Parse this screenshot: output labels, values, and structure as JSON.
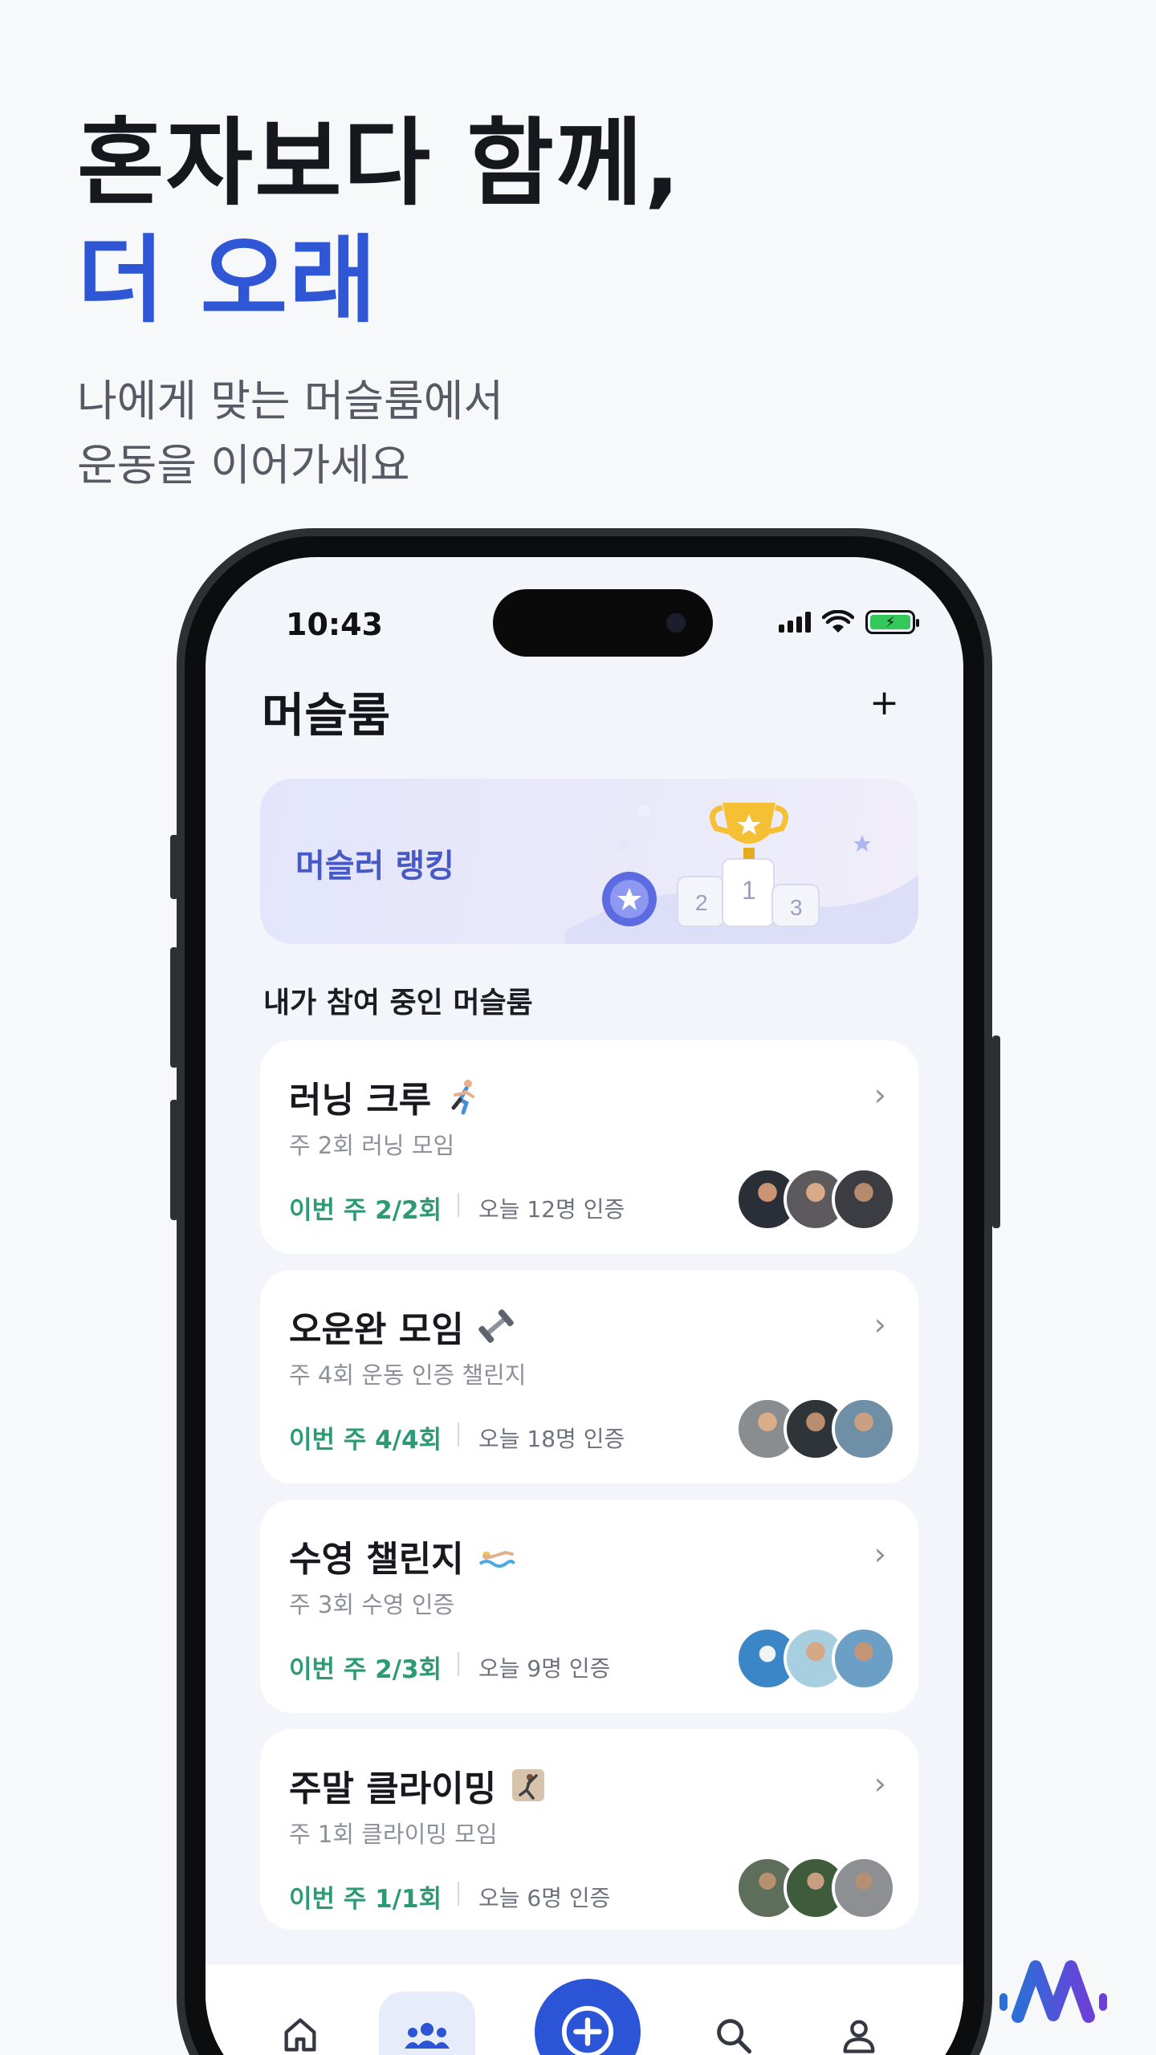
{
  "hero": {
    "line1": "혼자보다 함께,",
    "line2": "더 오래",
    "sub1": "나에게 맞는 머슬룸에서",
    "sub2": "운동을 이어가세요"
  },
  "status": {
    "time": "10:43"
  },
  "header": {
    "title": "머슬룸",
    "add_label": "+"
  },
  "banner": {
    "label": "머슬러 랭킹"
  },
  "section": {
    "title": "내가 참여 중인 머슬룸"
  },
  "rooms": [
    {
      "title": "러닝 크루",
      "emoji": "running-icon",
      "desc": "주 2회 러닝 모임",
      "week": "이번 주 2/2회",
      "today": "오늘 12명 인증"
    },
    {
      "title": "오운완 모임",
      "emoji": "dumbbell-icon",
      "desc": "주 4회 운동 인증 챌린지",
      "week": "이번 주 4/4회",
      "today": "오늘 18명 인증"
    },
    {
      "title": "수영 챌린지",
      "emoji": "swimming-icon",
      "desc": "주 3회 수영 인증",
      "week": "이번 주 2/3회",
      "today": "오늘 9명 인증"
    },
    {
      "title": "주말 클라이밍",
      "emoji": "climbing-icon",
      "desc": "주 1회 클라이밍 모임",
      "week": "이번 주 1/1회",
      "today": "오늘 6명 인증"
    }
  ],
  "tabs": [
    {
      "icon": "home-icon"
    },
    {
      "icon": "group-icon",
      "active": true
    },
    {
      "icon": "add-circle-icon"
    },
    {
      "icon": "search-icon"
    },
    {
      "icon": "profile-icon"
    }
  ],
  "colors": {
    "accent": "#2f56d4",
    "green": "#2b9a75",
    "fab": "#2b55d6"
  }
}
